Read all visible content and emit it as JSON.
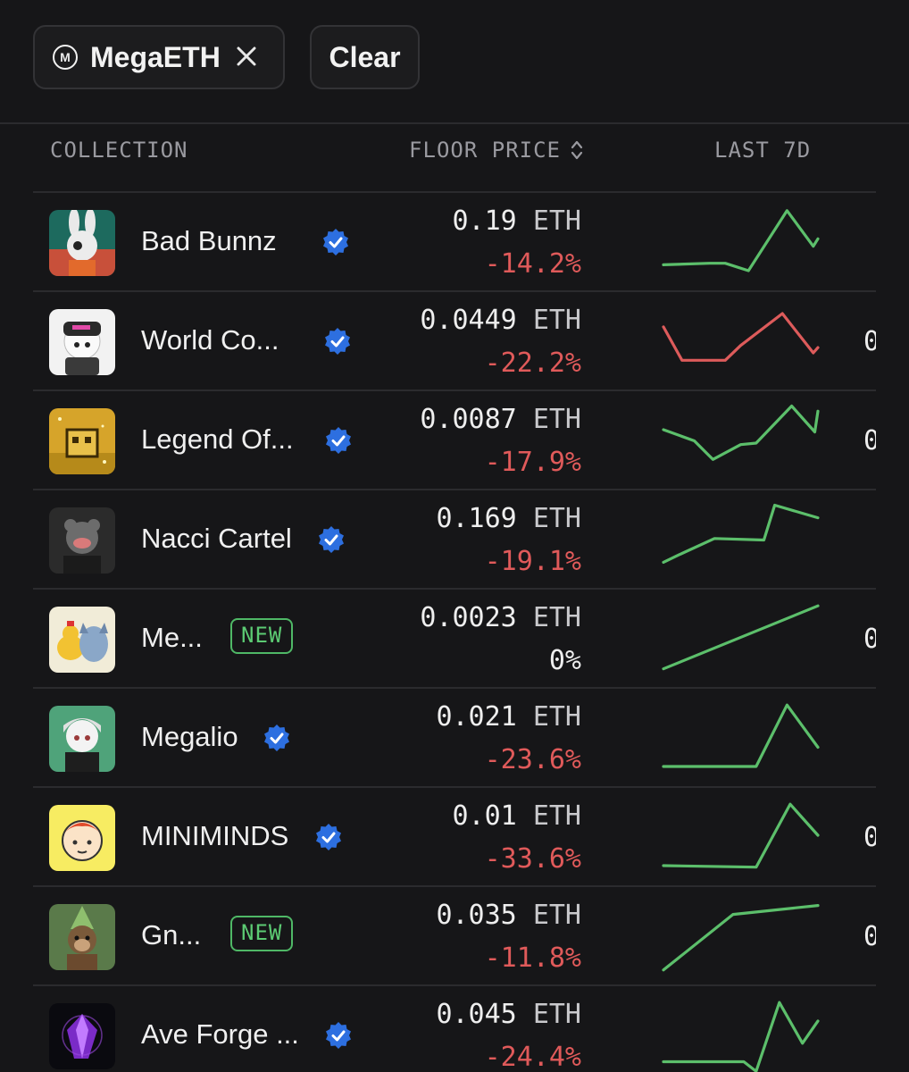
{
  "filters": {
    "network_chip": {
      "logo_letter": "M",
      "label": "MegaETH"
    },
    "clear_label": "Clear"
  },
  "table": {
    "columns": {
      "collection": "COLLECTION",
      "floor_price": "FLOOR PRICE",
      "last_7d": "LAST 7D"
    },
    "rows": [
      {
        "name": "Bad Bunnz",
        "verified": true,
        "new": false,
        "floor": "0.19",
        "unit": "ETH",
        "change": "-14.2%",
        "trend": "up",
        "trail": "",
        "spark": [
          [
            0,
            0.2
          ],
          [
            0.3,
            0.22
          ],
          [
            0.4,
            0.22
          ],
          [
            0.55,
            0.12
          ],
          [
            0.8,
            0.93
          ],
          [
            0.97,
            0.45
          ],
          [
            1,
            0.55
          ]
        ]
      },
      {
        "name": "World Co...",
        "verified": true,
        "new": false,
        "floor": "0.0449",
        "unit": "ETH",
        "change": "-22.2%",
        "trend": "down",
        "trail": "0",
        "spark": [
          [
            0,
            0.7
          ],
          [
            0.12,
            0.25
          ],
          [
            0.4,
            0.25
          ],
          [
            0.5,
            0.45
          ],
          [
            0.77,
            0.88
          ],
          [
            0.97,
            0.35
          ],
          [
            1,
            0.42
          ]
        ]
      },
      {
        "name": "Legend Of...",
        "verified": true,
        "new": false,
        "floor": "0.0087",
        "unit": "ETH",
        "change": "-17.9%",
        "trend": "up",
        "trail": "0",
        "spark": [
          [
            0,
            0.65
          ],
          [
            0.2,
            0.5
          ],
          [
            0.32,
            0.25
          ],
          [
            0.5,
            0.45
          ],
          [
            0.6,
            0.47
          ],
          [
            0.83,
            0.97
          ],
          [
            0.98,
            0.62
          ],
          [
            1,
            0.9
          ]
        ]
      },
      {
        "name": "Nacci Cartel",
        "verified": true,
        "new": false,
        "floor": "0.169",
        "unit": "ETH",
        "change": "-19.1%",
        "trend": "up",
        "trail": "",
        "spark": [
          [
            0,
            0.2
          ],
          [
            0.1,
            0.3
          ],
          [
            0.33,
            0.52
          ],
          [
            0.65,
            0.5
          ],
          [
            0.72,
            0.97
          ],
          [
            1,
            0.8
          ]
        ]
      },
      {
        "name": "Me...",
        "verified": false,
        "new": true,
        "floor": "0.0023",
        "unit": "ETH",
        "change": "0%",
        "trend": "up",
        "trail": "0",
        "spark": [
          [
            0,
            0.1
          ],
          [
            1,
            0.95
          ]
        ]
      },
      {
        "name": "Megalio",
        "verified": true,
        "new": false,
        "floor": "0.021",
        "unit": "ETH",
        "change": "-23.6%",
        "trend": "up",
        "trail": "",
        "spark": [
          [
            0,
            0.12
          ],
          [
            0.6,
            0.12
          ],
          [
            0.8,
            0.95
          ],
          [
            1,
            0.38
          ]
        ]
      },
      {
        "name": "MINIMINDS",
        "verified": true,
        "new": false,
        "floor": "0.01",
        "unit": "ETH",
        "change": "-33.6%",
        "trend": "up",
        "trail": "0",
        "spark": [
          [
            0,
            0.12
          ],
          [
            0.6,
            0.1
          ],
          [
            0.82,
            0.95
          ],
          [
            1,
            0.53
          ]
        ]
      },
      {
        "name": "Gn...",
        "verified": false,
        "new": true,
        "floor": "0.035",
        "unit": "ETH",
        "change": "-11.8%",
        "trend": "up",
        "trail": "0",
        "spark": [
          [
            0,
            0.05
          ],
          [
            0.45,
            0.8
          ],
          [
            1,
            0.92
          ]
        ]
      },
      {
        "name": "Ave Forge ...",
        "verified": true,
        "new": false,
        "floor": "0.045",
        "unit": "ETH",
        "change": "-24.4%",
        "trend": "up",
        "trail": "",
        "spark": [
          [
            0,
            0.15
          ],
          [
            0.52,
            0.15
          ],
          [
            0.6,
            0.02
          ],
          [
            0.75,
            0.95
          ],
          [
            0.9,
            0.4
          ],
          [
            1,
            0.7
          ]
        ]
      }
    ],
    "badge_new_label": "NEW"
  },
  "colors": {
    "background": "#161618",
    "spark_up": "#5cbf6b",
    "spark_down": "#dd5b5b",
    "negative": "#e05a5a",
    "verified": "#2d6fe0",
    "new_badge": "#4fb866"
  },
  "icons": {
    "verified": "verified-badge-icon",
    "close": "close-icon",
    "sort": "sort-arrows-icon",
    "network": "megaeth-logo-icon"
  }
}
